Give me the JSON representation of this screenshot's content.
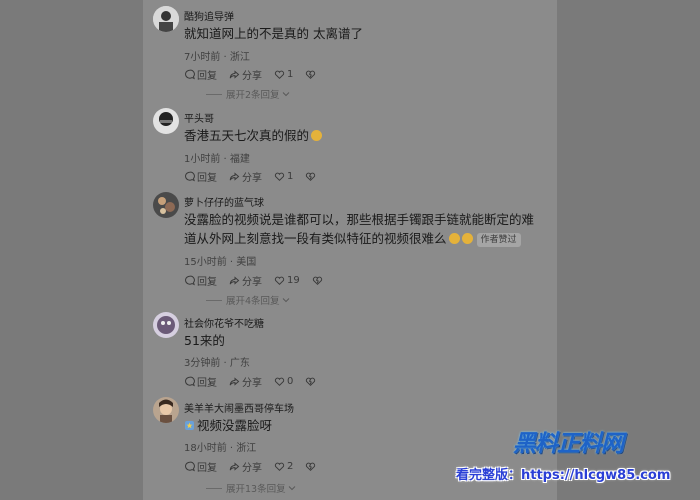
{
  "comments": [
    {
      "user": "酷狗追导弹",
      "text": "就知道网上的不是真的  太离谱了",
      "time": "7小时前 · 浙江",
      "reply": "回复",
      "share": "分享",
      "likes": "1",
      "expand": "展开2条回复"
    },
    {
      "user": "平头哥",
      "text": "香港五天七次真的假的",
      "time": "1小时前 · 福建",
      "reply": "回复",
      "share": "分享",
      "likes": "1"
    },
    {
      "user": "萝卜仔仔的蓝气球",
      "text1": "没露脸的视频说是谁都可以，那些根据手镯跟手链就能断定的难",
      "text2": "道从外网上刻意找一段有类似特征的视频很难么",
      "badge": "作者赞过",
      "time": "15小时前 · 美国",
      "reply": "回复",
      "share": "分享",
      "likes": "19",
      "expand": "展开4条回复"
    },
    {
      "user": "社会你花爷不吃糖",
      "text": "51来的",
      "time": "3分钟前 · 广东",
      "reply": "回复",
      "share": "分享",
      "likes": "0"
    },
    {
      "user": "美羊羊大闹墨西哥停车场",
      "text": "视频没露脸呀",
      "time": "18小时前 · 浙江",
      "reply": "回复",
      "share": "分享",
      "likes": "2",
      "expand": "展开13条回复"
    }
  ],
  "watermark": {
    "logo": "黑料正料网",
    "site": "看完整版：https://hlcgw85.com"
  },
  "colors": {
    "panel": "#8b8b8b",
    "background": "#7d7d7d",
    "watermark_blue": "#1e63c7"
  }
}
